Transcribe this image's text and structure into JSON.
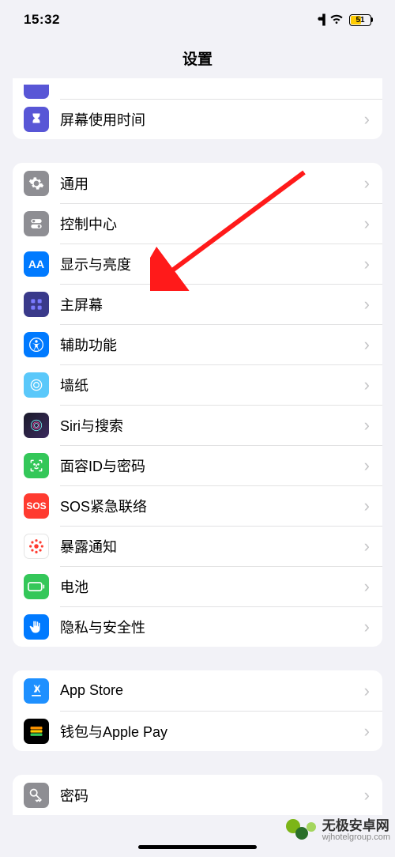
{
  "status": {
    "time": "15:32",
    "battery": "51"
  },
  "title": "设置",
  "groups": {
    "g0": {
      "screen_time": "屏幕使用时间"
    },
    "g1": {
      "general": "通用",
      "control_center": "控制中心",
      "display": "显示与亮度",
      "home_screen": "主屏幕",
      "accessibility": "辅助功能",
      "wallpaper": "墙纸",
      "siri": "Siri与搜索",
      "faceid": "面容ID与密码",
      "sos": "SOS紧急联络",
      "exposure": "暴露通知",
      "battery": "电池",
      "privacy": "隐私与安全性"
    },
    "g2": {
      "appstore": "App Store",
      "wallet": "钱包与Apple Pay"
    },
    "g3": {
      "passwords": "密码"
    }
  },
  "icons": {
    "sos_text": "SOS",
    "aa_text": "AA"
  },
  "watermark": {
    "cn": "无极安卓网",
    "url": "wjhotelgroup.com"
  }
}
